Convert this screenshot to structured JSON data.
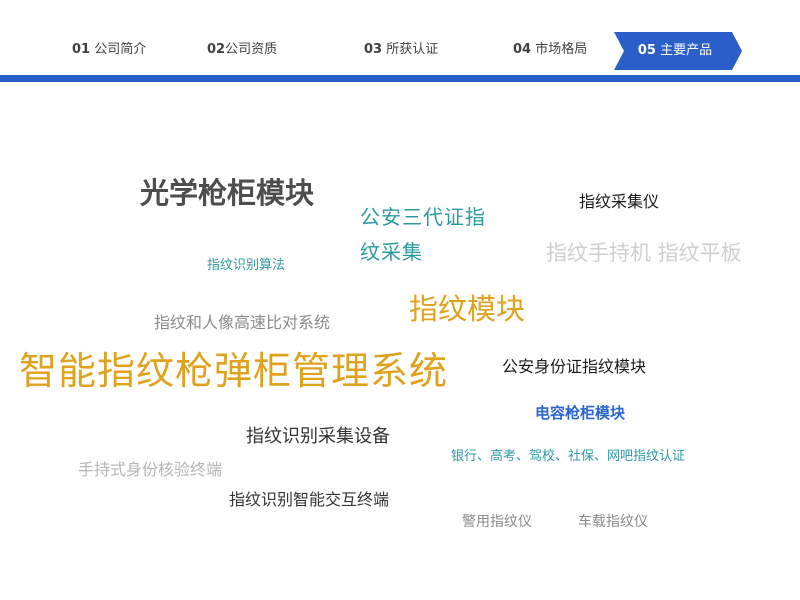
{
  "nav": {
    "items": [
      {
        "num": "01",
        "label": "公司简介"
      },
      {
        "num": "02",
        "label": "公司资质"
      },
      {
        "num": "03",
        "label": "所获认证"
      },
      {
        "num": "04",
        "label": "市场格局"
      },
      {
        "num": "05",
        "label": "主要产品"
      }
    ],
    "active_index": 4,
    "accent_color": "#2a5fc9"
  },
  "word_cloud": {
    "words": [
      {
        "text": "光学枪柜模块",
        "color": "#4d4d4d"
      },
      {
        "text": "公安三代证指纹采集",
        "color": "#2b9aa0"
      },
      {
        "text": "指纹采集仪",
        "color": "#1a1a1a"
      },
      {
        "text": "指纹识别算法",
        "color": "#2b9aa0"
      },
      {
        "text": "指纹手持机 指纹平板",
        "color": "#cfcfcf"
      },
      {
        "text": "指纹模块",
        "color": "#e0a21d"
      },
      {
        "text": "指纹和人像高速比对系统",
        "color": "#8a8a8a"
      },
      {
        "text": "智能指纹枪弹柜管理系统",
        "color": "#e0a21d"
      },
      {
        "text": "公安身份证指纹模块",
        "color": "#1a1a1a"
      },
      {
        "text": "电容枪柜模块",
        "color": "#2a66cc"
      },
      {
        "text": "指纹识别采集设备",
        "color": "#333333"
      },
      {
        "text": "银行、高考、驾校、社保、网吧指纹认证",
        "color": "#2b9aa0"
      },
      {
        "text": "手持式身份核验终端",
        "color": "#b5b5b5"
      },
      {
        "text": "指纹识别智能交互终端",
        "color": "#333333"
      },
      {
        "text": "警用指纹仪",
        "color": "#8a8a8a"
      },
      {
        "text": "车载指纹仪",
        "color": "#8a8a8a"
      }
    ]
  }
}
